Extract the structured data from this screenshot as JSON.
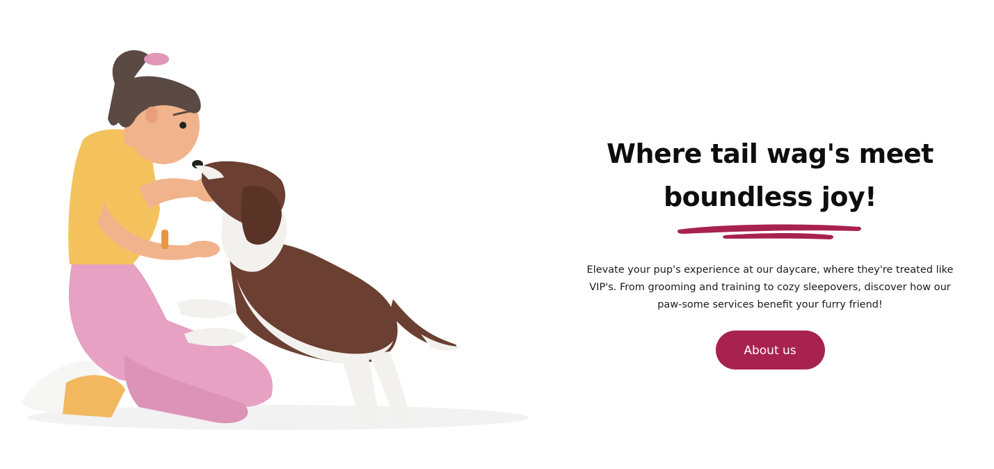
{
  "hero": {
    "headline_line1": "Where tail wag's meet",
    "headline_line2": "boundless joy!",
    "description": "Elevate your pup's experience at our daycare, where they're treated like VIP's. From grooming and training to cozy sleepovers, discover how our paw-some services benefit your furry friend!",
    "cta_label": "About us"
  },
  "colors": {
    "accent": "#a8224f",
    "shirt": "#f4c35e",
    "pants": "#e6a1c3",
    "hair": "#5b4a43",
    "skin": "#f1b38c",
    "dog_brown": "#6b3f31",
    "dog_white": "#f3f1ee"
  },
  "icons": {
    "illustration": "woman-petting-dog-illustration",
    "underline": "brush-stroke-underline"
  }
}
